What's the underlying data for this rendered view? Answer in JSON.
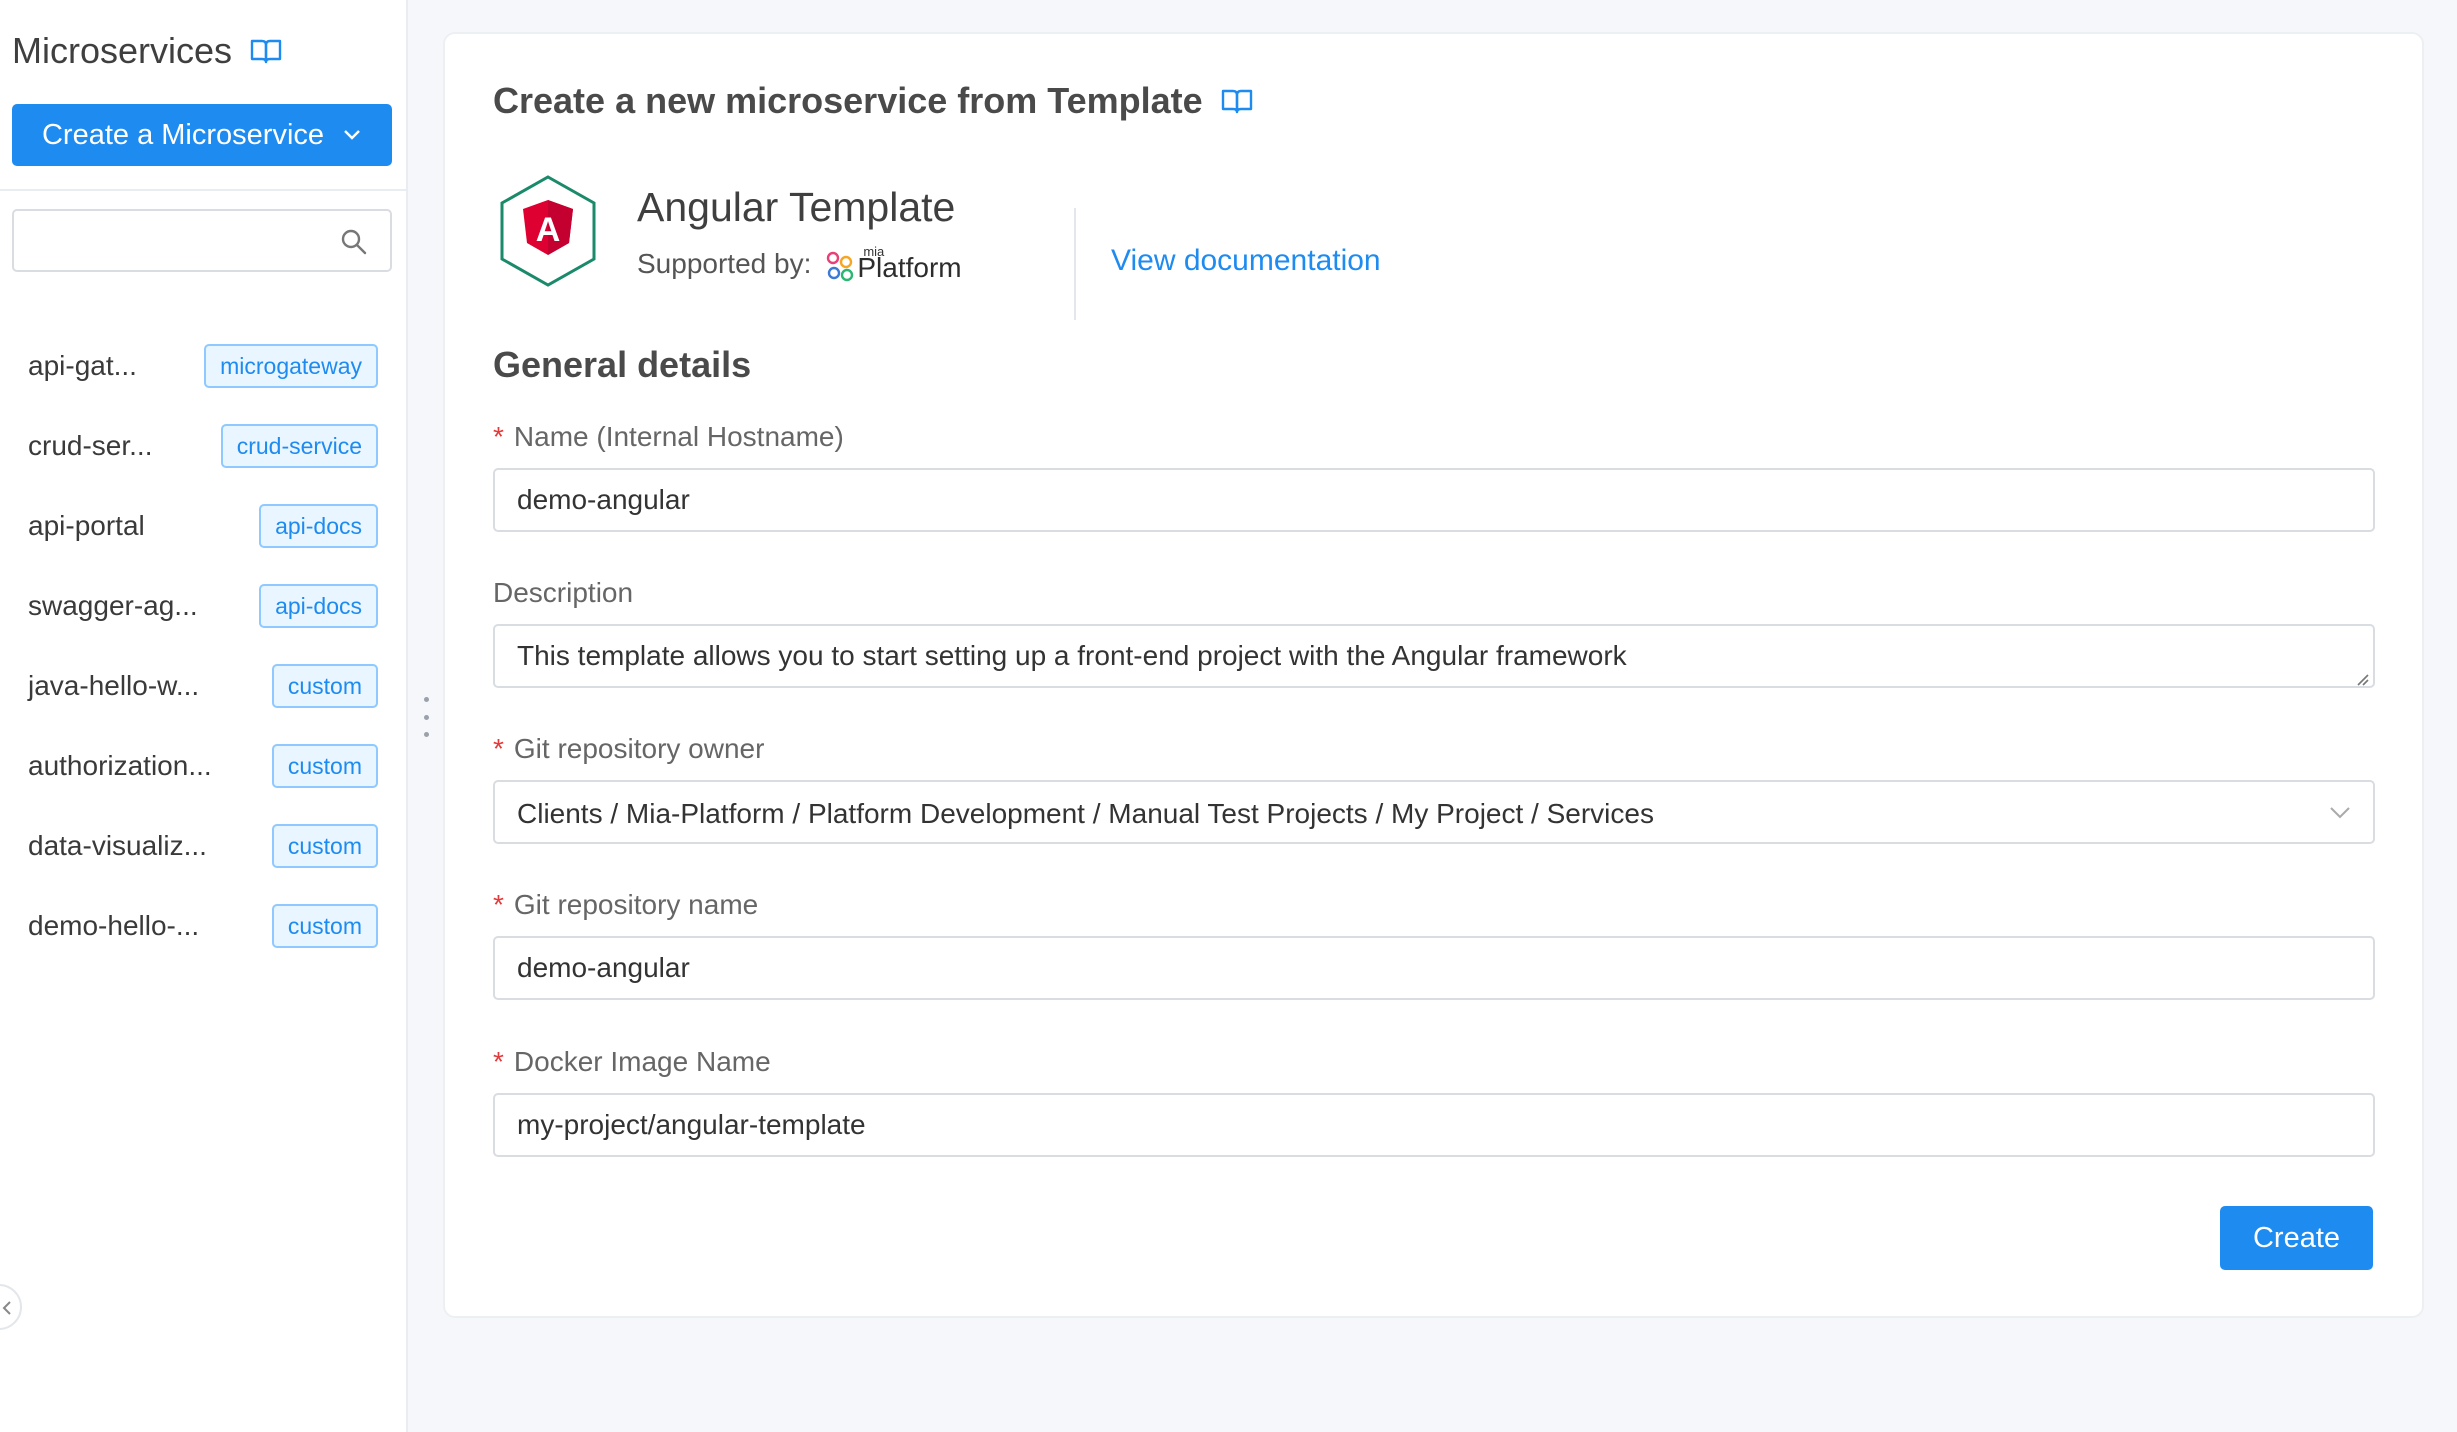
{
  "sidebar": {
    "title": "Microservices",
    "create_button_label": "Create a Microservice",
    "search": {
      "value": "",
      "placeholder": ""
    },
    "items": [
      {
        "name": "api-gat...",
        "tag": "microgateway"
      },
      {
        "name": "crud-ser...",
        "tag": "crud-service"
      },
      {
        "name": "api-portal",
        "tag": "api-docs"
      },
      {
        "name": "swagger-ag...",
        "tag": "api-docs"
      },
      {
        "name": "java-hello-w...",
        "tag": "custom"
      },
      {
        "name": "authorization...",
        "tag": "custom"
      },
      {
        "name": "data-visualiz...",
        "tag": "custom"
      },
      {
        "name": "demo-hello-...",
        "tag": "custom"
      }
    ]
  },
  "main": {
    "title": "Create a new microservice from Template",
    "template": {
      "logo_letter": "A",
      "name": "Angular Template",
      "supported_by_label": "Supported by:",
      "supporter_small": "mia",
      "supporter_big": "Platform",
      "doc_link": "View documentation"
    },
    "section_title": "General details",
    "fields": {
      "name": {
        "label": "Name (Internal Hostname)",
        "required": true,
        "value": "demo-angular"
      },
      "description": {
        "label": "Description",
        "required": false,
        "value": "This template allows you to start setting up a front-end project with the Angular framework"
      },
      "git_owner": {
        "label": "Git repository owner",
        "required": true,
        "value": "Clients / Mia-Platform / Platform Development / Manual Test Projects / My Project / Services"
      },
      "git_name": {
        "label": "Git repository name",
        "required": true,
        "value": "demo-angular"
      },
      "docker_image": {
        "label": "Docker Image Name",
        "required": true,
        "value": "my-project/angular-template"
      }
    },
    "required_marker": "*",
    "submit_label": "Create"
  },
  "icons": {
    "docs": "book-icon",
    "search": "search-icon",
    "dropdown": "chevron-down-icon",
    "collapse": "chevron-left-icon"
  },
  "colors": {
    "accent": "#1e8bf0",
    "required": "#e33b3b",
    "tag_border": "#8fc9ff",
    "tag_bg": "#e9f5ff",
    "angular_red": "#dd0031",
    "angular_hex": "#1a8a6a"
  }
}
